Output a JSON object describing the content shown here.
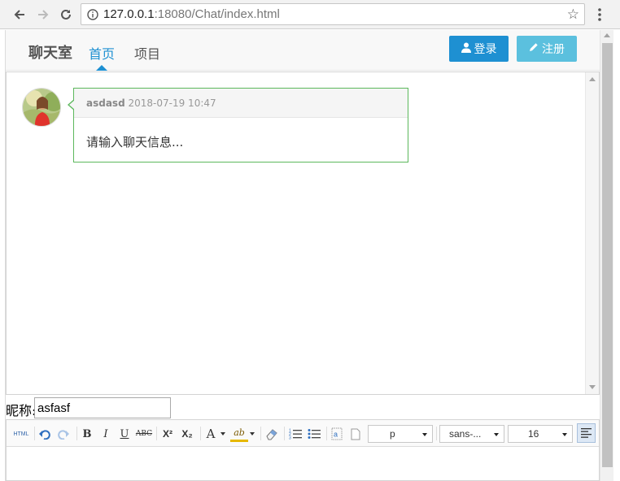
{
  "browser": {
    "url_host": "127.0.0.1",
    "url_path": ":18080/Chat/index.html"
  },
  "header": {
    "brand": "聊天室",
    "nav": {
      "home": "首页",
      "projects": "项目"
    },
    "login_label": "登录",
    "register_label": "注册",
    "colors": {
      "primary": "#1e90d2",
      "info": "#5bc0de"
    }
  },
  "chat": {
    "messages": [
      {
        "user": "asdasd",
        "time": "2018-07-19 10:47",
        "text": "请输入聊天信息..."
      }
    ],
    "bubble_border_color": "#5cb85c"
  },
  "nickname": {
    "label": "昵称:",
    "value": "asfasf"
  },
  "editor": {
    "html_label": "HTML",
    "bold": "B",
    "italic": "I",
    "underline": "U",
    "strike": "ABC",
    "sup": "X²",
    "sub": "X₂",
    "font_color": "A",
    "highlight": "ab",
    "paragraph_value": "p",
    "font_family_value": "sans-...",
    "font_size_value": "16"
  }
}
